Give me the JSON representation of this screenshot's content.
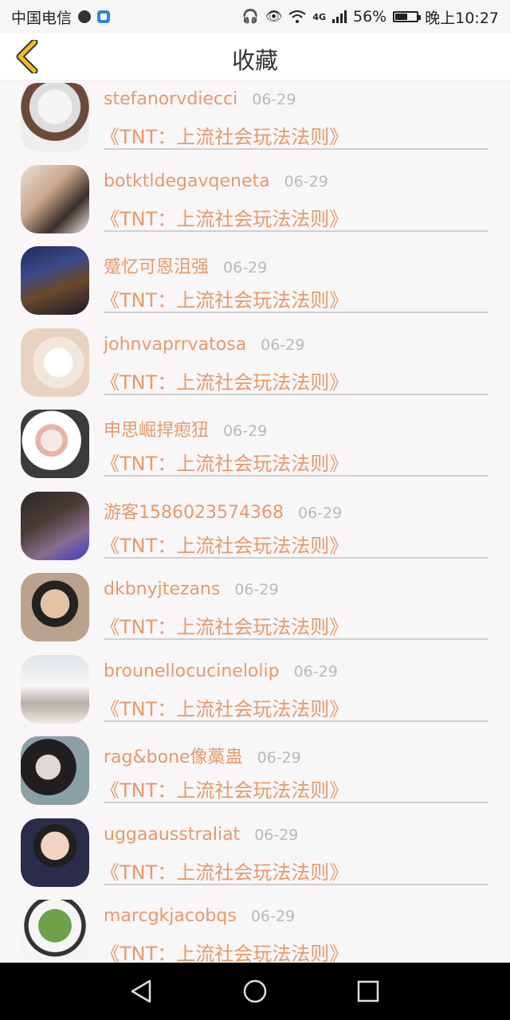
{
  "status_bar": {
    "carrier": "中国电信",
    "network": "4G",
    "battery_percent": "56%",
    "battery_level": 0.56,
    "time": "晚上10:27",
    "icons": [
      "globe-icon",
      "shield-app-icon",
      "headset-icon",
      "eye-icon",
      "wifi-icon",
      "signal-icon",
      "battery-icon"
    ]
  },
  "header": {
    "title": "收藏",
    "back_icon": "chevron-left-icon",
    "accent_color": "#f0c020"
  },
  "favorites": [
    {
      "name": "stefanorvdiecci",
      "date": "06-29",
      "title": "《TNT：上流社会玩法法则》"
    },
    {
      "name": "botktldegavqeneta",
      "date": "06-29",
      "title": "《TNT：上流社会玩法法则》"
    },
    {
      "name": "蹙忆可恩沮强",
      "date": "06-29",
      "title": "《TNT：上流社会玩法法则》"
    },
    {
      "name": "johnvaprrvatosa",
      "date": "06-29",
      "title": "《TNT：上流社会玩法法则》"
    },
    {
      "name": "申思崛捍瘛狃",
      "date": "06-29",
      "title": "《TNT：上流社会玩法法则》"
    },
    {
      "name": "游客1586023574368",
      "date": "06-29",
      "title": "《TNT：上流社会玩法法则》"
    },
    {
      "name": "dkbnyjtezans",
      "date": "06-29",
      "title": "《TNT：上流社会玩法法则》"
    },
    {
      "name": "brounellocucinelolip",
      "date": "06-29",
      "title": "《TNT：上流社会玩法法则》"
    },
    {
      "name": "rag&bone像藁蛊",
      "date": "06-29",
      "title": "《TNT：上流社会玩法法则》"
    },
    {
      "name": "uggaausstraliat",
      "date": "06-29",
      "title": "《TNT：上流社会玩法法则》"
    },
    {
      "name": "marcgkjacobqs",
      "date": "06-29",
      "title": "《TNT：上流社会玩法法则》"
    }
  ],
  "colors": {
    "name_text": "#e59a6a",
    "date_text": "#b9b9b9",
    "divider": "#cfcfcf",
    "background": "#f8f6f7"
  },
  "nav": {
    "icons": [
      "back-triangle-icon",
      "home-circle-icon",
      "recents-square-icon"
    ]
  }
}
